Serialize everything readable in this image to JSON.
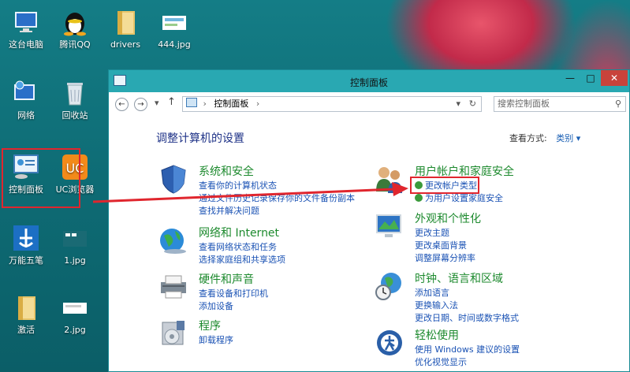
{
  "desktop": {
    "icons": [
      {
        "label": "这台电脑"
      },
      {
        "label": "腾讯QQ"
      },
      {
        "label": "drivers"
      },
      {
        "label": "444.jpg"
      },
      {
        "label": "网络"
      },
      {
        "label": "回收站"
      },
      {
        "label": "控制面板"
      },
      {
        "label": "UC浏览器"
      },
      {
        "label": "万能五笔"
      },
      {
        "label": "1.jpg"
      },
      {
        "label": "激活"
      },
      {
        "label": "2.jpg"
      }
    ]
  },
  "window": {
    "title": "控制面板",
    "controls": {
      "minimize": "—",
      "maximize": "□",
      "close": "✕"
    },
    "address": {
      "path": "控制面板",
      "search_placeholder": "搜索控制面板"
    },
    "main_title": "调整计算机的设置",
    "view_by": {
      "label": "查看方式:",
      "value": "类别 ▾"
    },
    "categories": [
      {
        "title": "系统和安全",
        "links": [
          "查看你的计算机状态",
          "通过文件历史记录保存你的文件备份副本",
          "查找并解决问题"
        ]
      },
      {
        "title": "网络和 Internet",
        "links": [
          "查看网络状态和任务",
          "选择家庭组和共享选项"
        ]
      },
      {
        "title": "硬件和声音",
        "links": [
          "查看设备和打印机",
          "添加设备"
        ]
      },
      {
        "title": "程序",
        "links": [
          "卸载程序"
        ]
      },
      {
        "title": "用户帐户和家庭安全",
        "links": [
          "更改帐户类型",
          "为用户设置家庭安全"
        ]
      },
      {
        "title": "外观和个性化",
        "links": [
          "更改主题",
          "更改桌面背景",
          "调整屏幕分辨率"
        ]
      },
      {
        "title": "时钟、语言和区域",
        "links": [
          "添加语言",
          "更换输入法",
          "更改日期、时间或数字格式"
        ]
      },
      {
        "title": "轻松使用",
        "links": [
          "使用 Windows 建议的设置",
          "优化视觉显示"
        ]
      }
    ]
  },
  "colors": {
    "highlight": "#e0262e",
    "titlebar": "#29a8b2",
    "link": "#1a52b4",
    "category_title": "#1d8a2e"
  }
}
